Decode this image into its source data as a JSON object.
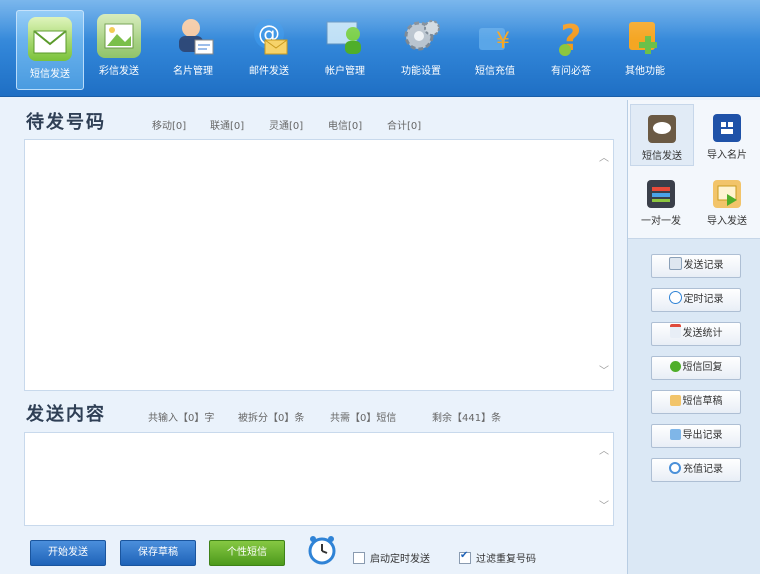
{
  "toolbar": {
    "items": [
      {
        "label": "短信发送",
        "icon": "sms-envelope-icon",
        "active": true
      },
      {
        "label": "彩信发送",
        "icon": "mms-picture-icon"
      },
      {
        "label": "名片管理",
        "icon": "contact-card-icon"
      },
      {
        "label": "邮件发送",
        "icon": "email-at-icon"
      },
      {
        "label": "帐户管理",
        "icon": "account-user-icon"
      },
      {
        "label": "功能设置",
        "icon": "gear-icon"
      },
      {
        "label": "短信充值",
        "icon": "recharge-yen-icon"
      },
      {
        "label": "有问必答",
        "icon": "question-mark-icon"
      },
      {
        "label": "其他功能",
        "icon": "plus-more-icon"
      }
    ]
  },
  "recipients": {
    "title": "待发号码",
    "stats": [
      "移动[0]",
      "联通[0]",
      "灵通[0]",
      "电信[0]",
      "合计[0]"
    ]
  },
  "message": {
    "title": "发送内容",
    "stats": [
      "共输入【0】字",
      "被拆分【0】条",
      "共需【0】短信",
      "剩余【441】条"
    ]
  },
  "actions": {
    "start": "开始发送",
    "save_draft": "保存草稿",
    "personalized": "个性短信",
    "timer_checkbox": "启动定时发送",
    "timer_checked": false,
    "filter_checkbox": "过滤重复号码",
    "filter_checked": true
  },
  "side": {
    "quick": [
      {
        "label": "短信发送",
        "icon": "chat-bubble-icon"
      },
      {
        "label": "导入名片",
        "icon": "import-card-icon"
      },
      {
        "label": "一对一发",
        "icon": "one-to-one-icon"
      },
      {
        "label": "导入发送",
        "icon": "import-send-icon"
      }
    ],
    "links": [
      {
        "label": "发送记录",
        "icon": "document-icon"
      },
      {
        "label": "定时记录",
        "icon": "clock-icon"
      },
      {
        "label": "发送统计",
        "icon": "calendar-icon"
      },
      {
        "label": "短信回复",
        "icon": "reply-icon"
      },
      {
        "label": "短信草稿",
        "icon": "pencil-icon"
      },
      {
        "label": "导出记录",
        "icon": "export-icon"
      },
      {
        "label": "充值记录",
        "icon": "search-icon"
      }
    ]
  },
  "colors": {
    "accent": "#2f83d6",
    "primary_button": "#1f63b8",
    "green_button": "#4d9a1c"
  }
}
